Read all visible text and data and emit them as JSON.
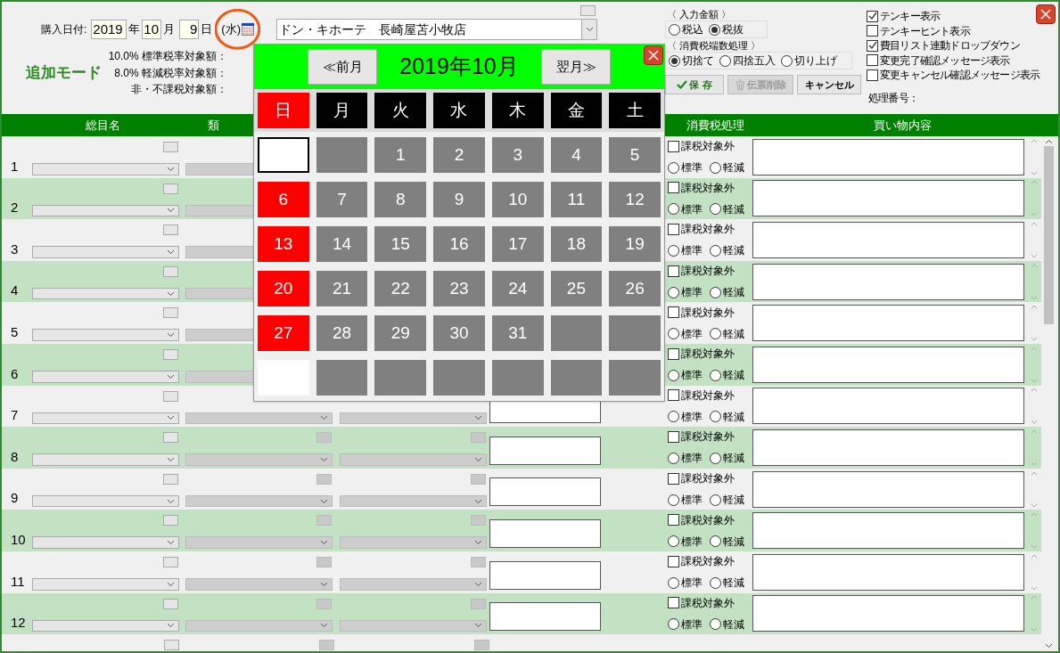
{
  "header": {
    "date_label": "購入日付:",
    "year": "2019",
    "year_unit": "年",
    "month": "10",
    "month_unit": "月",
    "day": "9",
    "day_unit": "日",
    "weekday": "(水)",
    "mode": "追加モード",
    "amount_labels": [
      "10.0% 標準税率対象額：",
      "8.0% 軽減税率対象額：",
      "非・不課税対象額："
    ],
    "store": "ドン・キホーテ　長崎屋苫小牧店"
  },
  "amount_input": {
    "title": "〈 入力金額 〉",
    "options": [
      {
        "label": "税込",
        "selected": false
      },
      {
        "label": "税抜",
        "selected": true
      }
    ]
  },
  "rounding": {
    "title": "〈 消費税端数処理 〉",
    "options": [
      {
        "label": "切捨て",
        "selected": true
      },
      {
        "label": "四捨五入",
        "selected": false
      },
      {
        "label": "切り上げ",
        "selected": false
      }
    ]
  },
  "buttons": [
    {
      "label": "保 存",
      "kind": "save",
      "disabled": false
    },
    {
      "label": "伝票削除",
      "kind": "delete",
      "disabled": true
    },
    {
      "label": "キャンセル",
      "kind": "cancel",
      "disabled": false
    }
  ],
  "options": [
    {
      "label": "テンキー表示",
      "checked": true
    },
    {
      "label": "テンキーヒント表示",
      "checked": false
    },
    {
      "label": "費目リスト連動ドロップダウン",
      "checked": true
    },
    {
      "label": "変更完了確認メッセージ表示",
      "checked": false
    },
    {
      "label": "変更キャンセル確認メッセージ表示",
      "checked": false
    }
  ],
  "process_number_label": "処理番号：",
  "table": {
    "columns": [
      "総目名",
      "類",
      "",
      "",
      "消費税処理",
      "買い物内容"
    ],
    "rows": [
      {
        "number": "1",
        "exempt": {
          "label": "課税対象外",
          "checked": false
        },
        "rates": [
          {
            "label": "標準",
            "selected": false
          },
          {
            "label": "軽減",
            "selected": false
          }
        ]
      },
      {
        "number": "2",
        "exempt": {
          "label": "課税対象外",
          "checked": false
        },
        "rates": [
          {
            "label": "標準",
            "selected": false
          },
          {
            "label": "軽減",
            "selected": false
          }
        ]
      },
      {
        "number": "3",
        "exempt": {
          "label": "課税対象外",
          "checked": false
        },
        "rates": [
          {
            "label": "標準",
            "selected": false
          },
          {
            "label": "軽減",
            "selected": false
          }
        ]
      },
      {
        "number": "4",
        "exempt": {
          "label": "課税対象外",
          "checked": false
        },
        "rates": [
          {
            "label": "標準",
            "selected": false
          },
          {
            "label": "軽減",
            "selected": false
          }
        ]
      },
      {
        "number": "5",
        "exempt": {
          "label": "課税対象外",
          "checked": false
        },
        "rates": [
          {
            "label": "標準",
            "selected": false
          },
          {
            "label": "軽減",
            "selected": false
          }
        ]
      },
      {
        "number": "6",
        "exempt": {
          "label": "課税対象外",
          "checked": false
        },
        "rates": [
          {
            "label": "標準",
            "selected": false
          },
          {
            "label": "軽減",
            "selected": false
          }
        ]
      },
      {
        "number": "7",
        "exempt": {
          "label": "課税対象外",
          "checked": false
        },
        "rates": [
          {
            "label": "標準",
            "selected": false
          },
          {
            "label": "軽減",
            "selected": false
          }
        ]
      },
      {
        "number": "8",
        "exempt": {
          "label": "課税対象外",
          "checked": false
        },
        "rates": [
          {
            "label": "標準",
            "selected": false
          },
          {
            "label": "軽減",
            "selected": false
          }
        ]
      },
      {
        "number": "9",
        "exempt": {
          "label": "課税対象外",
          "checked": false
        },
        "rates": [
          {
            "label": "標準",
            "selected": false
          },
          {
            "label": "軽減",
            "selected": false
          }
        ]
      },
      {
        "number": "10",
        "exempt": {
          "label": "課税対象外",
          "checked": false
        },
        "rates": [
          {
            "label": "標準",
            "selected": false
          },
          {
            "label": "軽減",
            "selected": false
          }
        ]
      },
      {
        "number": "11",
        "exempt": {
          "label": "課税対象外",
          "checked": false
        },
        "rates": [
          {
            "label": "標準",
            "selected": false
          },
          {
            "label": "軽減",
            "selected": false
          }
        ]
      },
      {
        "number": "12",
        "exempt": {
          "label": "課税対象外",
          "checked": false
        },
        "rates": [
          {
            "label": "標準",
            "selected": false
          },
          {
            "label": "軽減",
            "selected": false
          }
        ]
      }
    ]
  },
  "calendar": {
    "prev": "≪前月",
    "title": "2019年10月",
    "next": "翌月≫",
    "weekdays": [
      {
        "label": "日",
        "kind": "sunday"
      },
      {
        "label": "月",
        "kind": "weekday"
      },
      {
        "label": "火",
        "kind": "weekday"
      },
      {
        "label": "水",
        "kind": "weekday"
      },
      {
        "label": "木",
        "kind": "weekday"
      },
      {
        "label": "金",
        "kind": "weekday"
      },
      {
        "label": "土",
        "kind": "weekday"
      }
    ],
    "cells": [
      {
        "kind": "focus"
      },
      {
        "kind": "empty"
      },
      {
        "kind": "weekday",
        "day": "1"
      },
      {
        "kind": "weekday",
        "day": "2"
      },
      {
        "kind": "weekday",
        "day": "3"
      },
      {
        "kind": "weekday",
        "day": "4"
      },
      {
        "kind": "weekday",
        "day": "5"
      },
      {
        "kind": "sunday",
        "day": "6"
      },
      {
        "kind": "weekday",
        "day": "7"
      },
      {
        "kind": "weekday",
        "day": "8"
      },
      {
        "kind": "weekday",
        "day": "9"
      },
      {
        "kind": "weekday",
        "day": "10"
      },
      {
        "kind": "weekday",
        "day": "11"
      },
      {
        "kind": "weekday",
        "day": "12"
      },
      {
        "kind": "sunday",
        "day": "13"
      },
      {
        "kind": "weekday",
        "day": "14"
      },
      {
        "kind": "weekday",
        "day": "15"
      },
      {
        "kind": "weekday",
        "day": "16"
      },
      {
        "kind": "weekday",
        "day": "17"
      },
      {
        "kind": "weekday",
        "day": "18"
      },
      {
        "kind": "weekday",
        "day": "19"
      },
      {
        "kind": "sunday",
        "day": "20"
      },
      {
        "kind": "weekday",
        "day": "21"
      },
      {
        "kind": "weekday",
        "day": "22"
      },
      {
        "kind": "weekday",
        "day": "23"
      },
      {
        "kind": "weekday",
        "day": "24"
      },
      {
        "kind": "weekday",
        "day": "25"
      },
      {
        "kind": "weekday",
        "day": "26"
      },
      {
        "kind": "sunday",
        "day": "27"
      },
      {
        "kind": "weekday",
        "day": "28"
      },
      {
        "kind": "weekday",
        "day": "29"
      },
      {
        "kind": "weekday",
        "day": "30"
      },
      {
        "kind": "weekday",
        "day": "31"
      },
      {
        "kind": "empty"
      },
      {
        "kind": "empty"
      },
      {
        "kind": "white"
      },
      {
        "kind": "empty"
      },
      {
        "kind": "empty"
      },
      {
        "kind": "empty"
      },
      {
        "kind": "empty"
      },
      {
        "kind": "empty"
      },
      {
        "kind": "empty"
      }
    ]
  }
}
